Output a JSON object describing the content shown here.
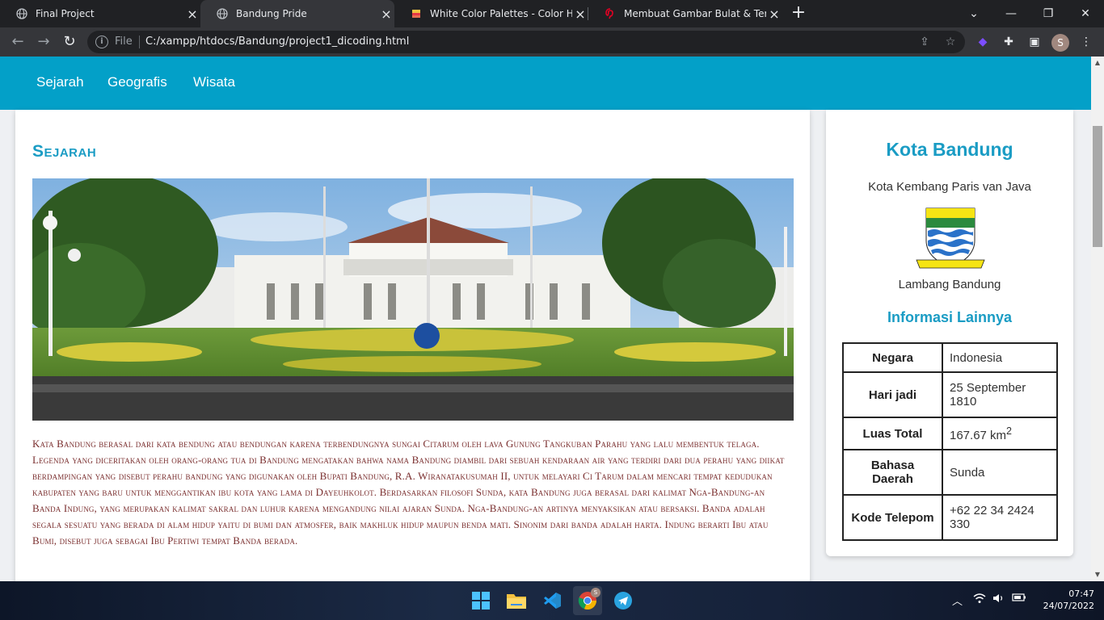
{
  "browser": {
    "tabs": [
      {
        "title": "Final Project",
        "icon": "globe-icon"
      },
      {
        "title": "Bandung Pride",
        "icon": "globe-icon",
        "active": true
      },
      {
        "title": "White Color Palettes - Color Hunt",
        "icon": "color-hunt-icon"
      },
      {
        "title": "Membuat Gambar Bulat & Terlihat",
        "icon": "pinterest-icon"
      }
    ],
    "address": {
      "scheme_label": "File",
      "url": "C:/xampp/htdocs/Bandung/project1_dicoding.html"
    },
    "profile_initial": "S"
  },
  "page": {
    "nav": {
      "items": [
        "Sejarah",
        "Geografis",
        "Wisata"
      ]
    },
    "main": {
      "section_title": "Sejarah",
      "paragraph": "Kata Bandung berasal dari kata bendung atau bendungan karena terbendungnya sungai Citarum oleh lava Gunung Tangkuban Parahu yang lalu membentuk telaga. Legenda yang diceritakan oleh orang-orang tua di Bandung mengatakan bahwa nama Bandung diambil dari sebuah kendaraan air yang terdiri dari dua perahu yang diikat berdampingan yang disebut perahu bandung yang digunakan oleh Bupati Bandung, R.A. Wiranatakusumah II, untuk melayari Ci Tarum dalam mencari tempat kedudukan kabupaten yang baru untuk menggantikan ibu kota yang lama di Dayeuhkolot. Berdasarkan filosofi Sunda, kata Bandung juga berasal dari kalimat Nga-Bandung-an Banda Indung, yang merupakan kalimat sakral dan luhur karena mengandung nilai ajaran Sunda. Nga-Bandung-an artinya menyaksikan atau bersaksi. Banda adalah segala sesuatu yang berada di alam hidup yaitu di bumi dan atmosfer, baik makhluk hidup maupun benda mati. Sinonim dari banda adalah harta. Indung berarti Ibu atau Bumi, disebut juga sebagai Ibu Pertiwi tempat Banda berada."
    },
    "aside": {
      "city_name": "Kota Bandung",
      "tagline": "Kota Kembang Paris van Java",
      "emblem_caption": "Lambang Bandung",
      "emblem_motto": "GEMAH RIPAH WIBAWA MUKTI",
      "info_heading": "Informasi Lainnya",
      "info_rows": [
        {
          "key": "Negara",
          "value": "Indonesia"
        },
        {
          "key": "Hari jadi",
          "value": "25 September 1810"
        },
        {
          "key": "Luas Total",
          "value": "167.67 km",
          "sup": "2"
        },
        {
          "key": "Bahasa Daerah",
          "value": "Sunda"
        },
        {
          "key": "Kode Telepom",
          "value": "+62 22 34 2424 330"
        }
      ]
    }
  },
  "taskbar": {
    "time": "07:47",
    "date": "24/07/2022"
  },
  "colors": {
    "accent": "#03a0c8",
    "heading": "#1a9cc4",
    "body_text": "#7a2e2e"
  }
}
